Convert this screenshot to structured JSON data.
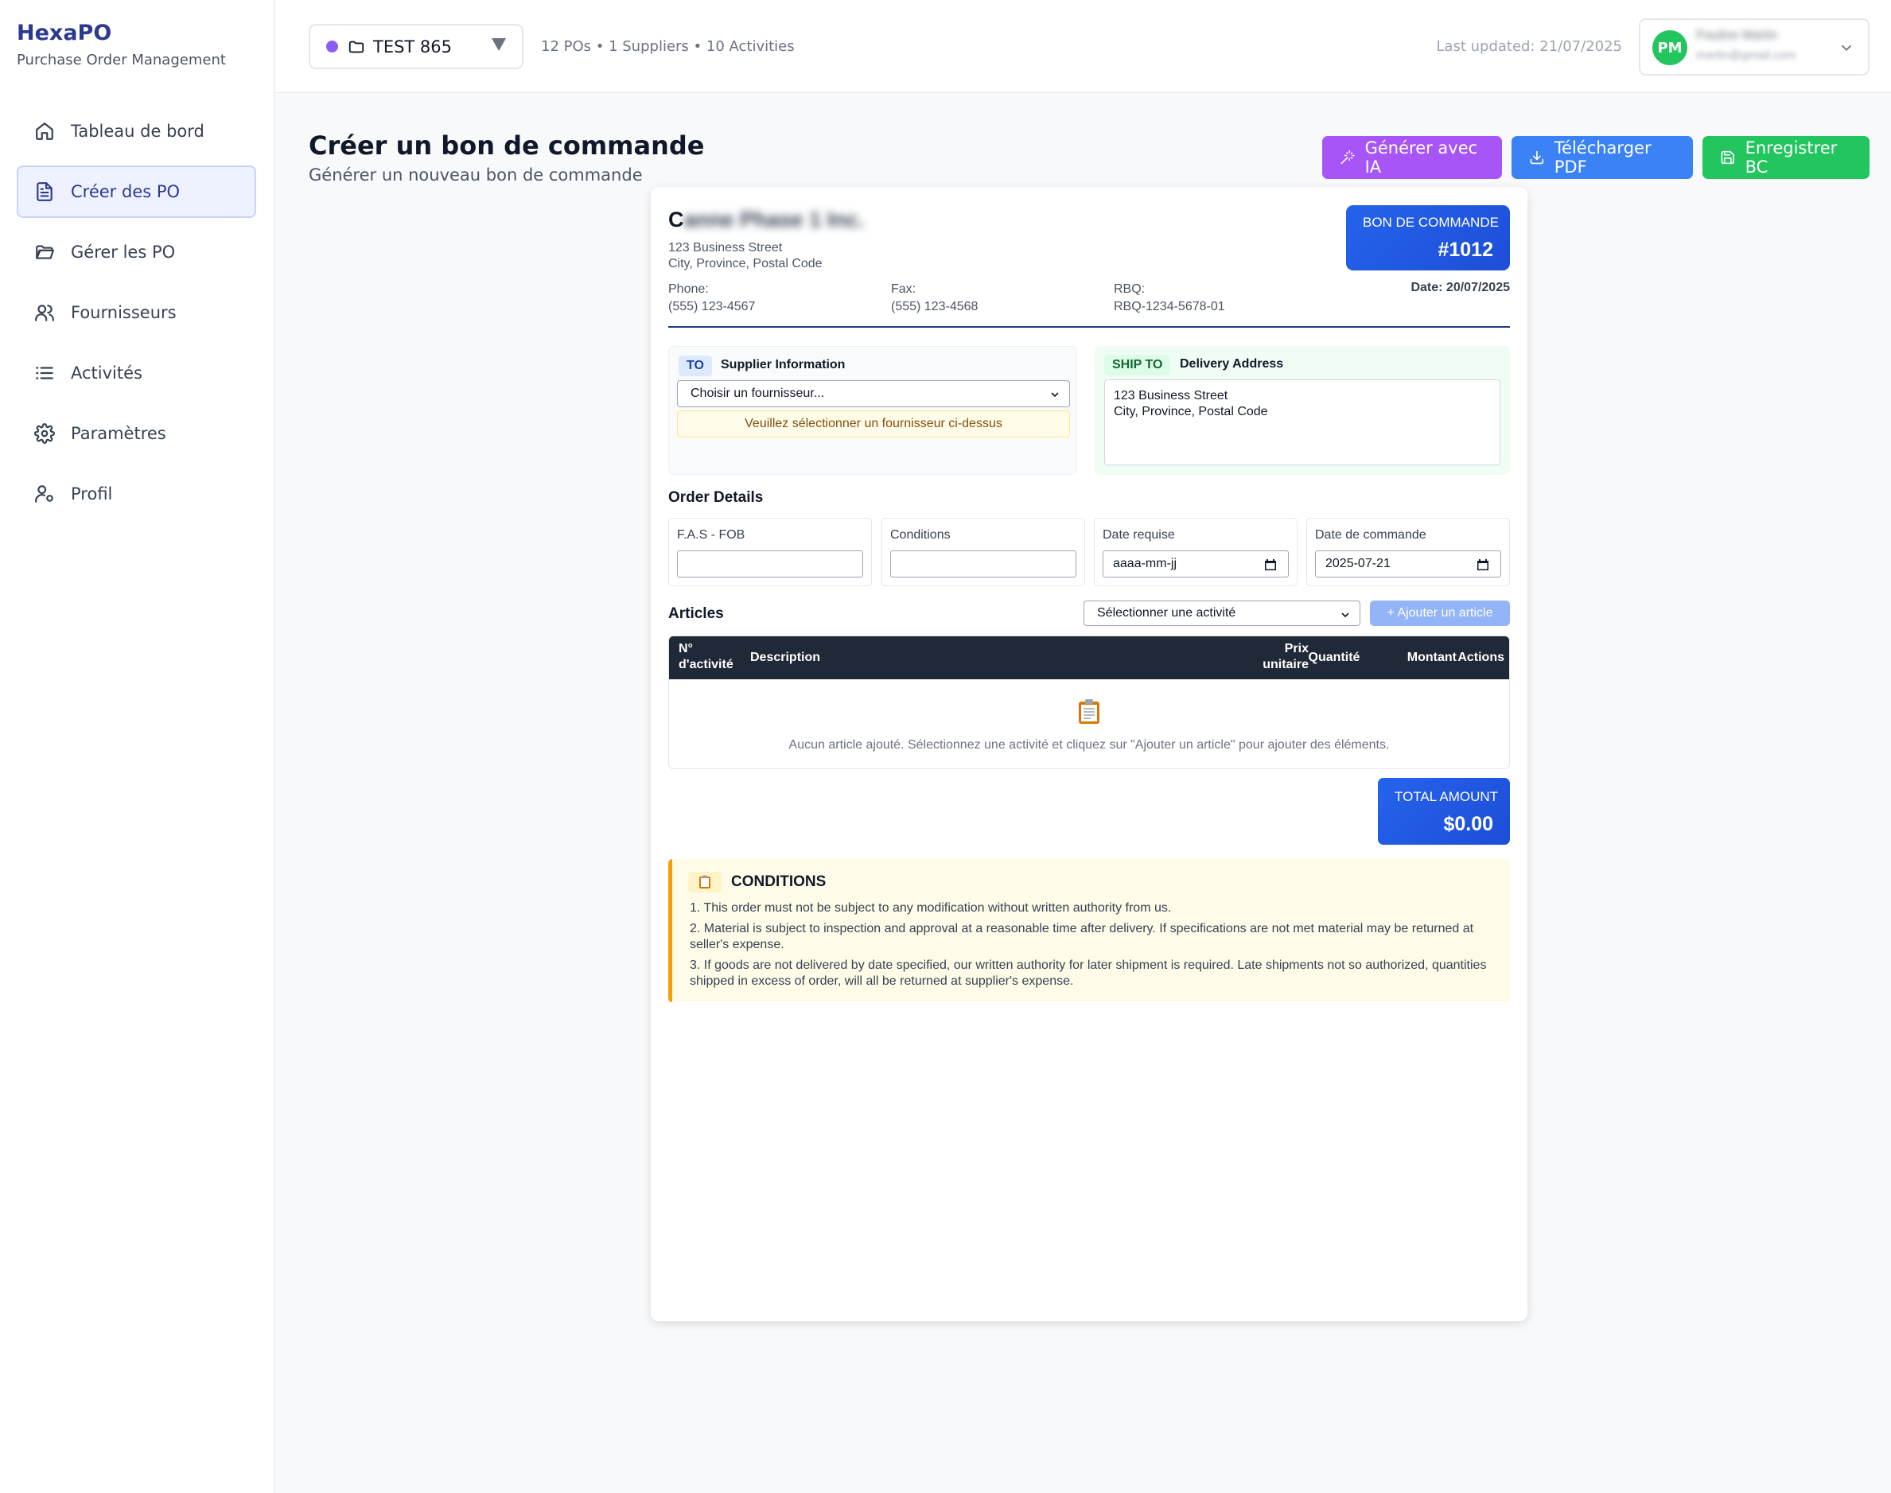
{
  "brand": {
    "name": "HexaPO",
    "subtitle": "Purchase Order Management"
  },
  "sidebar": {
    "items": [
      {
        "label": "Tableau de bord",
        "icon": "home-icon",
        "active": false
      },
      {
        "label": "Créer des PO",
        "icon": "file-text-icon",
        "active": true
      },
      {
        "label": "Gérer les PO",
        "icon": "folder-open-icon",
        "active": false
      },
      {
        "label": "Fournisseurs",
        "icon": "users-icon",
        "active": false
      },
      {
        "label": "Activités",
        "icon": "list-icon",
        "active": false
      },
      {
        "label": "Paramètres",
        "icon": "gear-icon",
        "active": false
      },
      {
        "label": "Profil",
        "icon": "user-cog-icon",
        "active": false
      }
    ]
  },
  "topbar": {
    "project": "TEST 865",
    "project_color": "#8b5cf6",
    "stats": "12 POs • 1 Suppliers • 10 Activities",
    "last_updated": "Last updated: 21/07/2025",
    "user": {
      "initials": "PM",
      "name": "Pauline Martin",
      "email": "martin@gmail.com",
      "avatar_color": "#22c55e"
    }
  },
  "page": {
    "title": "Créer un bon de commande",
    "subtitle": "Générer un nouveau bon de commande",
    "actions": {
      "ai": "Générer avec IA",
      "pdf": "Télécharger PDF",
      "save": "Enregistrer BC"
    }
  },
  "po": {
    "company_initial": "C",
    "company_rest": "anne Phase 1 Inc.",
    "address_line1": "123 Business Street",
    "address_line2": "City, Province, Postal Code",
    "phone_label": "Phone:",
    "phone": "(555) 123-4567",
    "fax_label": "Fax:",
    "fax": "(555) 123-4568",
    "rbq_label": "RBQ:",
    "rbq": "RBQ-1234-5678-01",
    "badge_label": "BON DE COMMANDE",
    "number": "#1012",
    "date": "Date: 20/07/2025",
    "to_tag": "TO",
    "to_title": "Supplier Information",
    "supplier_select": "Choisir un fournisseur...",
    "supplier_warning": "Veuillez sélectionner un fournisseur ci-dessus",
    "ship_tag": "SHIP TO",
    "ship_title": "Delivery Address",
    "ship_line1": "123 Business Street",
    "ship_line2": "City, Province, Postal Code",
    "order_details_title": "Order Details",
    "fields": {
      "fas_label": "F.A.S - FOB",
      "fas_value": "",
      "conditions_label": "Conditions",
      "conditions_value": "",
      "date_req_label": "Date requise",
      "date_req_value": "aaaa-mm-jj",
      "date_cmd_label": "Date de commande",
      "date_cmd_value": "2025-07-21"
    },
    "articles_title": "Articles",
    "activity_select": "Sélectionner une activité",
    "add_article": "+ Ajouter un article",
    "table": {
      "headers": {
        "activity_no": "N°",
        "activity_no2": "d'activité",
        "description": "Description",
        "unit_price": "Prix",
        "unit_price2": "unitaire",
        "quantity": "Quantité",
        "amount": "Montant",
        "actions": "Actions"
      },
      "empty": "Aucun article ajouté. Sélectionnez une activité et cliquez sur \"Ajouter un article\" pour ajouter des éléments."
    },
    "total_label": "TOTAL AMOUNT",
    "total_value": "$0.00",
    "conditions_title": "CONDITIONS",
    "conditions": [
      "1. This order must not be subject to any modification without written authority from us.",
      "2. Material is subject to inspection and approval at a reasonable time after delivery. If specifications are not met material may be returned at seller's expense.",
      "3. If goods are not delivered by date specified, our written authority for later shipment is required. Late shipments not so authorized, quantities shipped in excess of order, will all be returned at supplier's expense."
    ]
  }
}
